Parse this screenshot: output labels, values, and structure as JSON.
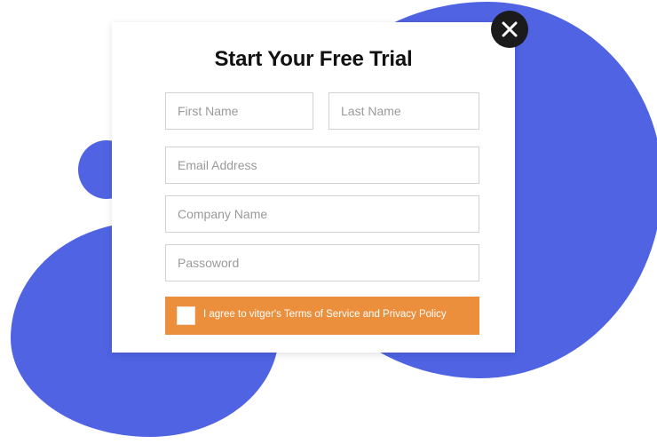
{
  "popup": {
    "title": "Start Your Free Trial",
    "fields": {
      "first_name_placeholder": "First Name",
      "last_name_placeholder": "Last Name",
      "email_placeholder": "Email Address",
      "company_placeholder": "Company Name",
      "password_placeholder": "Passoword"
    },
    "agree_label": "I agree to vitger's Terms of Service and Privacy Policy",
    "close_icon": "close-icon"
  },
  "colors": {
    "accent_blue": "#4f63e3",
    "agree_orange": "#ec8f3d",
    "close_bg": "#1b1b1b"
  }
}
